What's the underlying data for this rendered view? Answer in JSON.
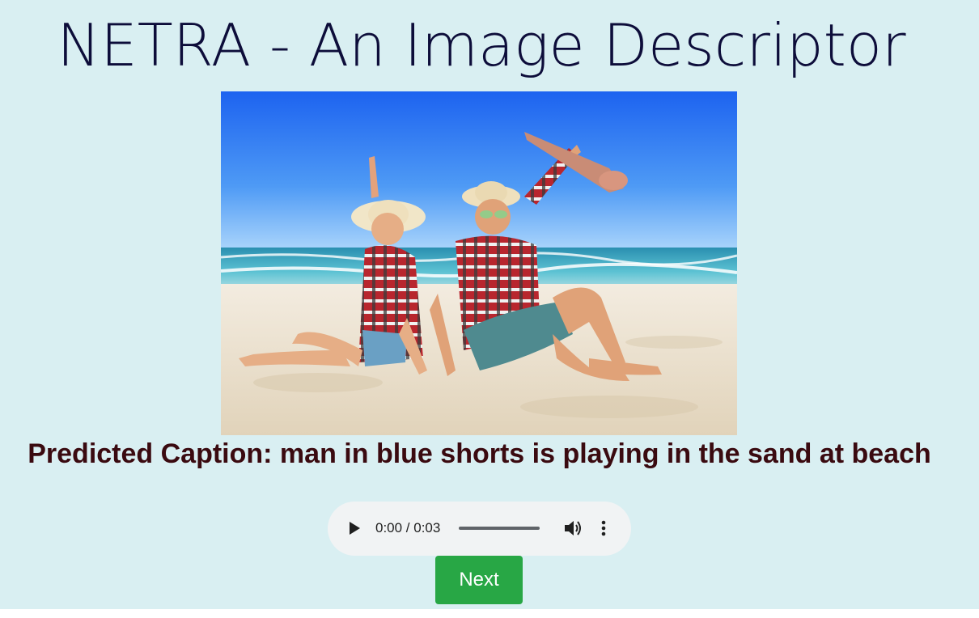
{
  "page": {
    "title": "NETRA - An Image Descriptor",
    "background_color": "#d9eff2"
  },
  "image": {
    "scene": "beach-photo",
    "sky_color": "#2a7af2",
    "sea_color": "#3fb0c8",
    "sand_color": "#ece2cf"
  },
  "caption": {
    "text": "Predicted Caption: man in blue shorts is playing in the sand at beach",
    "color": "#3a0a10"
  },
  "audio_player": {
    "time_display": "0:00 / 0:03",
    "progress": 0,
    "play_icon": "play-icon",
    "volume_icon": "volume-icon",
    "more_icon": "more-vertical-icon"
  },
  "next_button": {
    "label": "Next",
    "color": "#28a745"
  }
}
